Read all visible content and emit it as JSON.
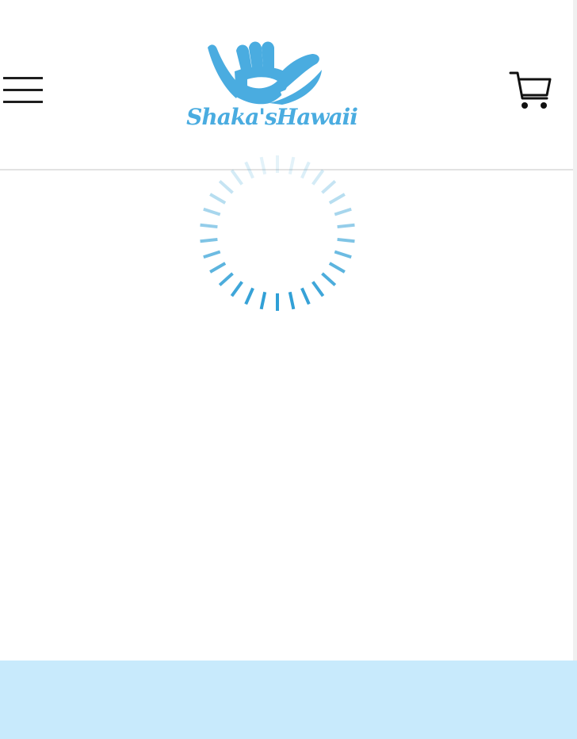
{
  "header": {
    "menu_icon": "hamburger-menu-icon",
    "logo": {
      "text": "Shaka'sHawaii",
      "icon": "shaka-hand-icon",
      "color": "#4aace0"
    },
    "cart_icon": "shopping-cart-icon"
  },
  "main": {
    "loading_icon": "loading-spinner-icon",
    "spinner_color": "#2f9fd6"
  },
  "footer": {
    "background_color": "#c8eafc"
  }
}
